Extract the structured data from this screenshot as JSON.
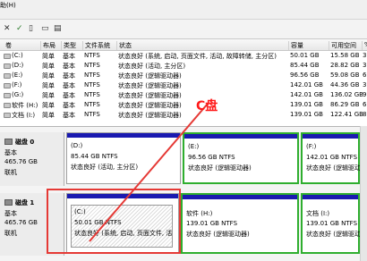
{
  "menu": {
    "help_label": "助(H)"
  },
  "toolbar": {
    "icons": [
      "close-icon",
      "check-icon",
      "document-icon",
      "folder-icon",
      "properties-icon"
    ]
  },
  "table": {
    "headers": [
      "卷",
      "布局",
      "类型",
      "文件系统",
      "状态",
      "容量",
      "可用空间",
      "%"
    ],
    "rows": [
      {
        "vol": "(C:)",
        "layout": "简单",
        "type": "基本",
        "fs": "NTFS",
        "status": "状态良好 (系统, 启动, 页面文件, 活动, 故障转储, 主分区)",
        "capacity": "50.01 GB",
        "free": "15.58 GB",
        "pct": "3"
      },
      {
        "vol": "(D:)",
        "layout": "简单",
        "type": "基本",
        "fs": "NTFS",
        "status": "状态良好 (活动, 主分区)",
        "capacity": "85.44 GB",
        "free": "28.82 GB",
        "pct": "3"
      },
      {
        "vol": "(E:)",
        "layout": "简单",
        "type": "基本",
        "fs": "NTFS",
        "status": "状态良好 (逻辑驱动器)",
        "capacity": "96.56 GB",
        "free": "59.08 GB",
        "pct": "6"
      },
      {
        "vol": "(F:)",
        "layout": "简单",
        "type": "基本",
        "fs": "NTFS",
        "status": "状态良好 (逻辑驱动器)",
        "capacity": "142.01 GB",
        "free": "44.36 GB",
        "pct": "3"
      },
      {
        "vol": "(G:)",
        "layout": "简单",
        "type": "基本",
        "fs": "NTFS",
        "status": "状态良好 (逻辑驱动器)",
        "capacity": "142.01 GB",
        "free": "136.02 GB",
        "pct": "9"
      },
      {
        "vol": "软件 (H:)",
        "layout": "简单",
        "type": "基本",
        "fs": "NTFS",
        "status": "状态良好 (逻辑驱动器)",
        "capacity": "139.01 GB",
        "free": "86.29 GB",
        "pct": "6"
      },
      {
        "vol": "文档 (I:)",
        "layout": "简单",
        "type": "基本",
        "fs": "NTFS",
        "status": "状态良好 (逻辑驱动器)",
        "capacity": "139.01 GB",
        "free": "122.41 GB",
        "pct": "8"
      }
    ]
  },
  "disks": [
    {
      "name": "磁盘 0",
      "type": "基本",
      "size": "465.76 GB",
      "status": "联机"
    },
    {
      "name": "磁盘 1",
      "type": "基本",
      "size": "465.76 GB",
      "status": "联机"
    }
  ],
  "partitions": {
    "d": {
      "title": "(D:)",
      "size": "85.44 GB NTFS",
      "status": "状态良好 (活动, 主分区)"
    },
    "e": {
      "title": "(E:)",
      "size": "96.56 GB NTFS",
      "status": "状态良好 (逻辑驱动器)"
    },
    "f": {
      "title": "(F:)",
      "size": "142.01 GB NTFS",
      "status": "状态良好 (逻辑驱动器)"
    },
    "c": {
      "title": "(C:)",
      "size": "50.01 GB NTFS",
      "status": "状态良好 (系统, 启动, 页面文件, 活"
    },
    "h": {
      "title": "软件 (H:)",
      "size": "139.01 GB NTFS",
      "status": "状态良好 (逻辑驱动器)"
    },
    "i": {
      "title": "文档 (I:)",
      "size": "139.01 GB NTFS",
      "status": "状态良好 (逻辑驱动器)"
    }
  },
  "annotation": {
    "label": "C盘",
    "color": "#ff1a1a"
  },
  "colors": {
    "primary_bar": "#1a1ab0",
    "logical_border": "#2fae2f"
  }
}
